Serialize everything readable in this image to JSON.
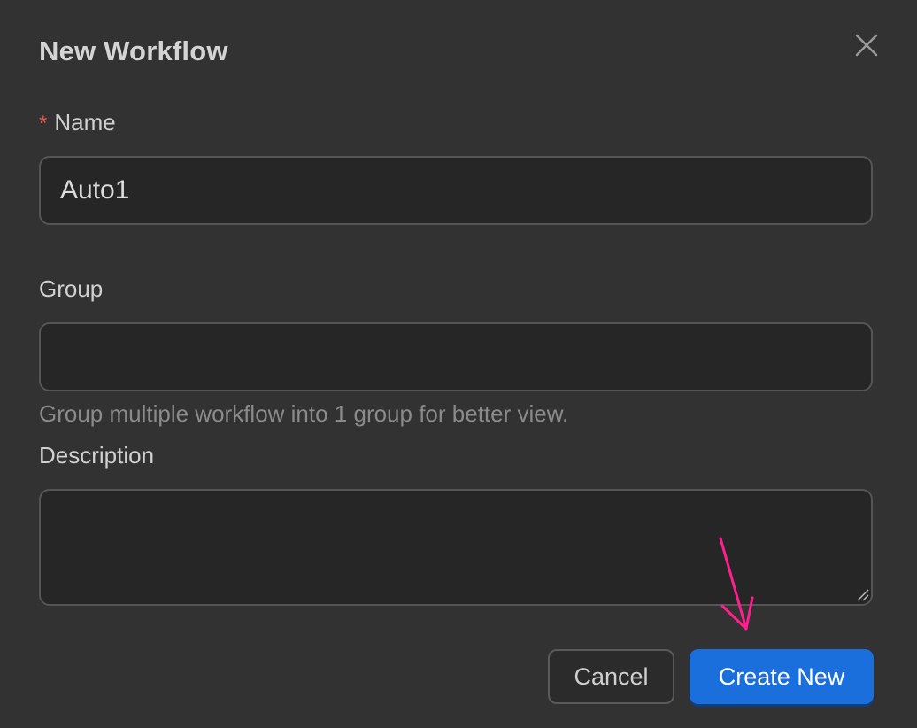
{
  "dialog": {
    "title": "New Workflow",
    "close_icon": "close-icon"
  },
  "form": {
    "name": {
      "required_mark": "*",
      "label": "Name",
      "value": "Auto1"
    },
    "group": {
      "label": "Group",
      "value": "",
      "hint": "Group multiple workflow into 1 group for better view."
    },
    "description": {
      "label": "Description",
      "value": ""
    }
  },
  "actions": {
    "cancel_label": "Cancel",
    "create_label": "Create New",
    "create_color": "#1a6fdc"
  },
  "annotation": {
    "arrow_color": "#ff1f8e",
    "arrow_icon": "arrow-down-icon"
  }
}
